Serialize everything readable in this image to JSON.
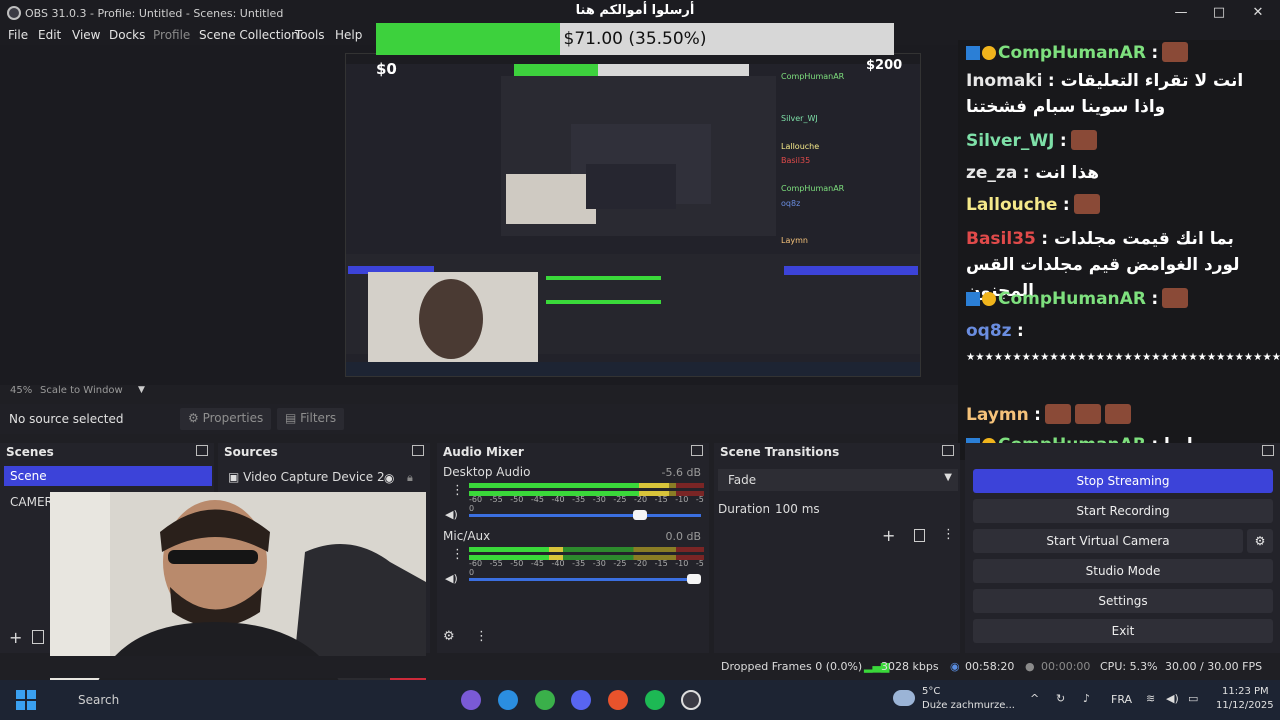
{
  "window": {
    "title": "OBS 31.0.3 - Profile: Untitled - Scenes: Untitled",
    "controls": [
      "—",
      "□",
      "✕"
    ]
  },
  "menu": {
    "items": [
      "File",
      "Edit",
      "View",
      "Docks",
      "Profile",
      "Scene Collection",
      "Tools",
      "Help"
    ]
  },
  "goal": {
    "title": "أرسلوا أموالكم هنا",
    "amount_text": "$71.00 (35.50%)",
    "progress": 0.355,
    "min_label": "$0",
    "max_label": "$200"
  },
  "preview": {
    "zoom": "45%",
    "mode": "Scale to Window"
  },
  "source_toolbar": {
    "status": "No source selected",
    "properties": "Properties",
    "filters": "Filters"
  },
  "chat": {
    "messages": [
      {
        "user": "CompHumanAR",
        "text": ":",
        "color": "#7ee07e",
        "badges": true,
        "emotes": 1
      },
      {
        "user": "Inomaki",
        "text": ": انت لا تقراء التعليقات واذا سوينا سبام فشختنا",
        "color": "#e8e8e8",
        "badges": false,
        "emotes": 0
      },
      {
        "user": "Silver_WJ",
        "text": ":",
        "color": "#7ee0a8",
        "badges": false,
        "emotes": 1
      },
      {
        "user": "ze_za",
        "text": ": هذا انت",
        "color": "#e8e8e8",
        "badges": false,
        "emotes": 0
      },
      {
        "user": "Lallouche",
        "text": ":",
        "color": "#f5e98a",
        "badges": false,
        "emotes": 1
      },
      {
        "user": "Basil35",
        "text": ": بما انك قيمت مجلدات لورد الغوامض قيم مجلدات القس المجنون",
        "color": "#e04a4a",
        "badges": false,
        "emotes": 0
      },
      {
        "user": "CompHumanAR",
        "text": ":",
        "color": "#7ee07e",
        "badges": true,
        "emotes": 1
      },
      {
        "user": "oq8z",
        "text": ": ٭٭٭٭٭٭٭٭٭٭٭٭٭٭٭٭٭٭٭٭٭٭٭٭٭٭٭٭٭٭٭٭٭٭٭٭",
        "color": "#6a8de0",
        "badges": false,
        "emotes": 0
      },
      {
        "user": "Laymn",
        "text": ":",
        "color": "#f5c27a",
        "badges": false,
        "emotes": 3
      },
      {
        "user": "CompHumanAR",
        "text": ": ايوا...",
        "color": "#7ee07e",
        "badges": true,
        "emotes": 0
      }
    ]
  },
  "docks": {
    "scenes": {
      "title": "Scenes",
      "items": [
        "Scene",
        "CAMERA"
      ]
    },
    "sources": {
      "title": "Sources",
      "items": [
        "Video Capture Device 2"
      ]
    },
    "mixer": {
      "title": "Audio Mixer",
      "channels": [
        {
          "name": "Desktop Audio",
          "db": "-5.6 dB",
          "level": 0.85,
          "volume": 0.75
        },
        {
          "name": "Mic/Aux",
          "db": "0.0 dB",
          "level": 0.4,
          "volume": 1.0
        }
      ],
      "scale": [
        "-60",
        "-55",
        "-50",
        "-45",
        "-40",
        "-35",
        "-30",
        "-25",
        "-20",
        "-15",
        "-10",
        "-5",
        "0"
      ]
    },
    "transitions": {
      "title": "Scene Transitions",
      "selected": "Fade",
      "duration_label": "Duration",
      "duration_value": "100 ms"
    },
    "controls": {
      "buttons": [
        "Stop Streaming",
        "Start Recording",
        "Start Virtual Camera",
        "Studio Mode",
        "Settings",
        "Exit"
      ]
    }
  },
  "status": {
    "dropped": "Dropped Frames 0 (0.0%)",
    "bitrate": "3028 kbps",
    "stream_time": "00:58:20",
    "rec_time": "00:00:00",
    "cpu": "CPU: 5.3%",
    "fps": "30.00 / 30.00 FPS"
  },
  "taskbar": {
    "search": "Search",
    "weather_temp": "5°C",
    "weather_desc": "Duże zachmurze...",
    "lang": "FRA",
    "time": "11:23 PM",
    "date": "11/12/2025"
  },
  "colors": {
    "accent": "#3c43d9",
    "goal_fill": "#3dd13d",
    "chat_bg": "#18181b"
  }
}
